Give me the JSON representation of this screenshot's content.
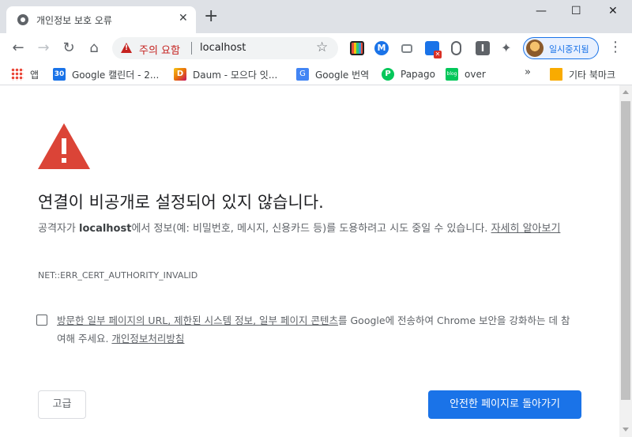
{
  "browser": {
    "tab": {
      "title": "개인정보 보호 오류",
      "close": "✕"
    },
    "new_tab": "+",
    "window_controls": {
      "minimize": "—",
      "maximize": "☐",
      "close": "✕"
    },
    "toolbar": {
      "back": "←",
      "forward": "→",
      "reload": "↻",
      "home": "⌂",
      "security_warning": "주의 요함",
      "url": "localhost",
      "star": "☆",
      "extension_m": "M",
      "extension_i": "I",
      "extension_badge": "✕",
      "puzzle": "✦",
      "profile_label": "일시중지됨",
      "menu": "⋮"
    },
    "bookmarks": [
      {
        "label": "앱",
        "icon": "apps-icon",
        "glyph": ""
      },
      {
        "label": "Google 캘린더 - 2...",
        "icon": "calendar-icon",
        "glyph": "30"
      },
      {
        "label": "Daum - 모으다 잇...",
        "icon": "daum-icon",
        "glyph": "D"
      },
      {
        "label": "Google 번역",
        "icon": "translate-icon",
        "glyph": "G"
      },
      {
        "label": "Papago",
        "icon": "papago-icon",
        "glyph": "P"
      },
      {
        "label": "over",
        "icon": "blog-icon",
        "glyph": "blog"
      }
    ],
    "bookmarks_more": "»",
    "other_bookmarks": "기타 북마크"
  },
  "interstitial": {
    "headline": "연결이 비공개로 설정되어 있지 않습니다.",
    "explain_prefix": "공격자가 ",
    "explain_host": "localhost",
    "explain_rest": "에서 정보(예: 비밀번호, 메시지, 신용카드 등)를 도용하려고 시도 중일 수 있습니다. ",
    "learn_more": "자세히 알아보기",
    "error_code": "NET::ERR_CERT_AUTHORITY_INVALID",
    "report_link_text": "방문한 일부 페이지의 URL, 제한된 시스템 정보, 일부 페이지 콘텐츠",
    "report_rest": "를 Google에 전송하여 Chrome 보안을 강화하는 데 참여해 주세요. ",
    "privacy_link": "개인정보처리방침",
    "report_checked": false,
    "advanced_button": "고급",
    "back_button": "안전한 페이지로 돌아가기"
  },
  "colors": {
    "warning_red": "#db4437",
    "primary_blue": "#1a73e8",
    "secondary_text": "#5f6368"
  }
}
